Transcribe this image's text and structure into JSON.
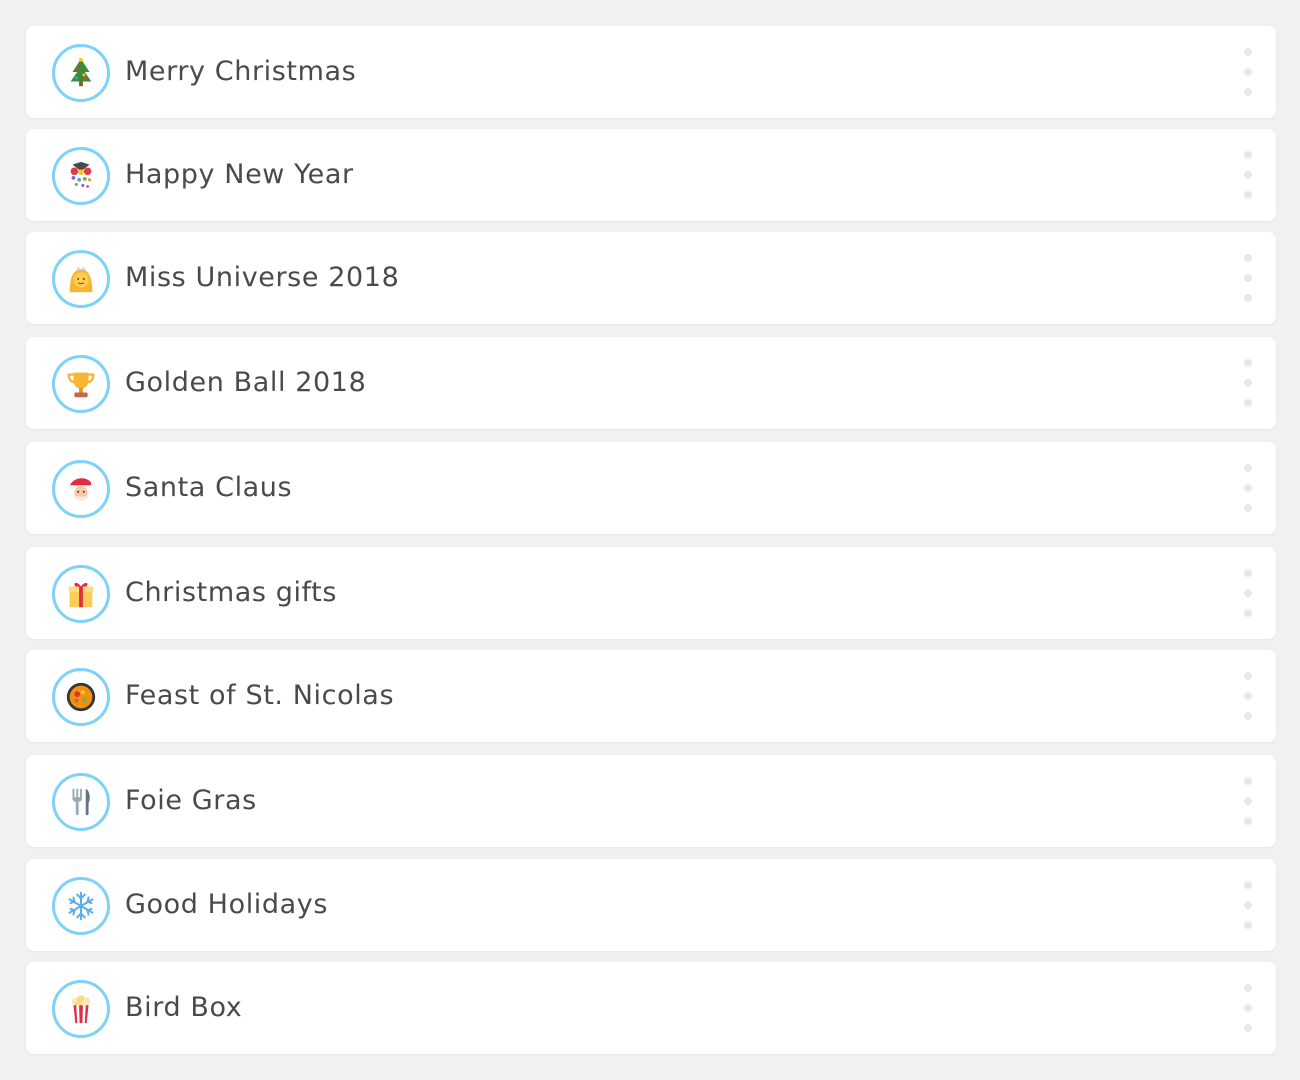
{
  "events": [
    {
      "label": "Merry Christmas",
      "icon": "christmas-tree-icon"
    },
    {
      "label": "Happy New Year",
      "icon": "party-popper-icon"
    },
    {
      "label": "Miss Universe 2018",
      "icon": "princess-icon"
    },
    {
      "label": "Golden Ball 2018",
      "icon": "trophy-icon"
    },
    {
      "label": "Santa Claus",
      "icon": "santa-icon"
    },
    {
      "label": "Christmas gifts",
      "icon": "gift-icon"
    },
    {
      "label": "Feast of St. Nicolas",
      "icon": "paella-icon"
    },
    {
      "label": "Foie Gras",
      "icon": "fork-knife-icon"
    },
    {
      "label": "Good Holidays",
      "icon": "snowflake-icon"
    },
    {
      "label": "Bird Box",
      "icon": "popcorn-icon"
    }
  ],
  "colors": {
    "background": "#f1f1f2",
    "card": "#ffffff",
    "avatar_ring": "#7dd3f7",
    "text": "#4a4a4a",
    "menu_dots": "#e9e9ea"
  }
}
